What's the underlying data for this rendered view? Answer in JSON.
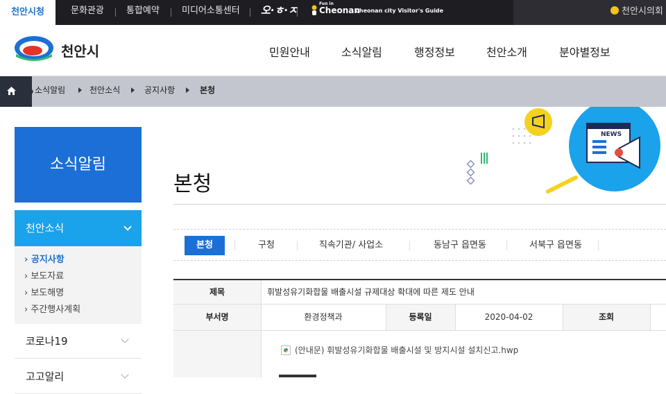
{
  "topbar": {
    "active_tab": "천안시청",
    "links": [
      "문화관광",
      "통합예약",
      "미디어소통센터"
    ],
    "ohs_logo": "오·ㅎ·ㅈ",
    "fun_in": "Fun in",
    "cheonan_logo": "Cheonan",
    "visitor_guide": "Cheonan city Visitor's Guide",
    "council": "천안시의회"
  },
  "header": {
    "logo_text": "천안시",
    "gnb": [
      "민원안내",
      "소식알림",
      "행정정보",
      "천안소개",
      "분야별정보"
    ]
  },
  "breadcrumb": [
    "소식알림",
    "천안소식",
    "공지사항",
    "본청"
  ],
  "sidebar": {
    "title": "소식알림",
    "active_menu": "천안소식",
    "sub_items": [
      {
        "label": "공지사항",
        "active": true
      },
      {
        "label": "보도자료",
        "active": false
      },
      {
        "label": "보도해명",
        "active": false
      },
      {
        "label": "주간행사계획",
        "active": false
      }
    ],
    "menus": [
      "코로나19",
      "고고알리"
    ]
  },
  "main": {
    "page_title": "본청",
    "banner_news_text": "NEWS",
    "tabs": [
      {
        "label": "본청",
        "active": true
      },
      {
        "label": "구청",
        "active": false
      },
      {
        "label": "직속기관/ 사업소",
        "active": false
      },
      {
        "label": "동남구 읍면동",
        "active": false
      },
      {
        "label": "서북구 읍면동",
        "active": false
      }
    ],
    "table": {
      "title_label": "제목",
      "title_value": "휘발성유기화합물 배출시설 규제대상 확대에 따른 제도 안내",
      "dept_label": "부서명",
      "dept_value": "환경정책과",
      "date_label": "등록일",
      "date_value": "2020-04-02",
      "views_label": "조회",
      "attachment": "(안내문) 휘발성유기화합물 배출시설 및 방지시설 설치신고.hwp"
    }
  },
  "colors": {
    "primary_blue": "#1c6fd6",
    "light_blue": "#1aa2ea",
    "dark_bar": "#1e1e22",
    "breadcrumb_bg": "#c4c6cf",
    "accent_yellow": "#f0c419"
  }
}
